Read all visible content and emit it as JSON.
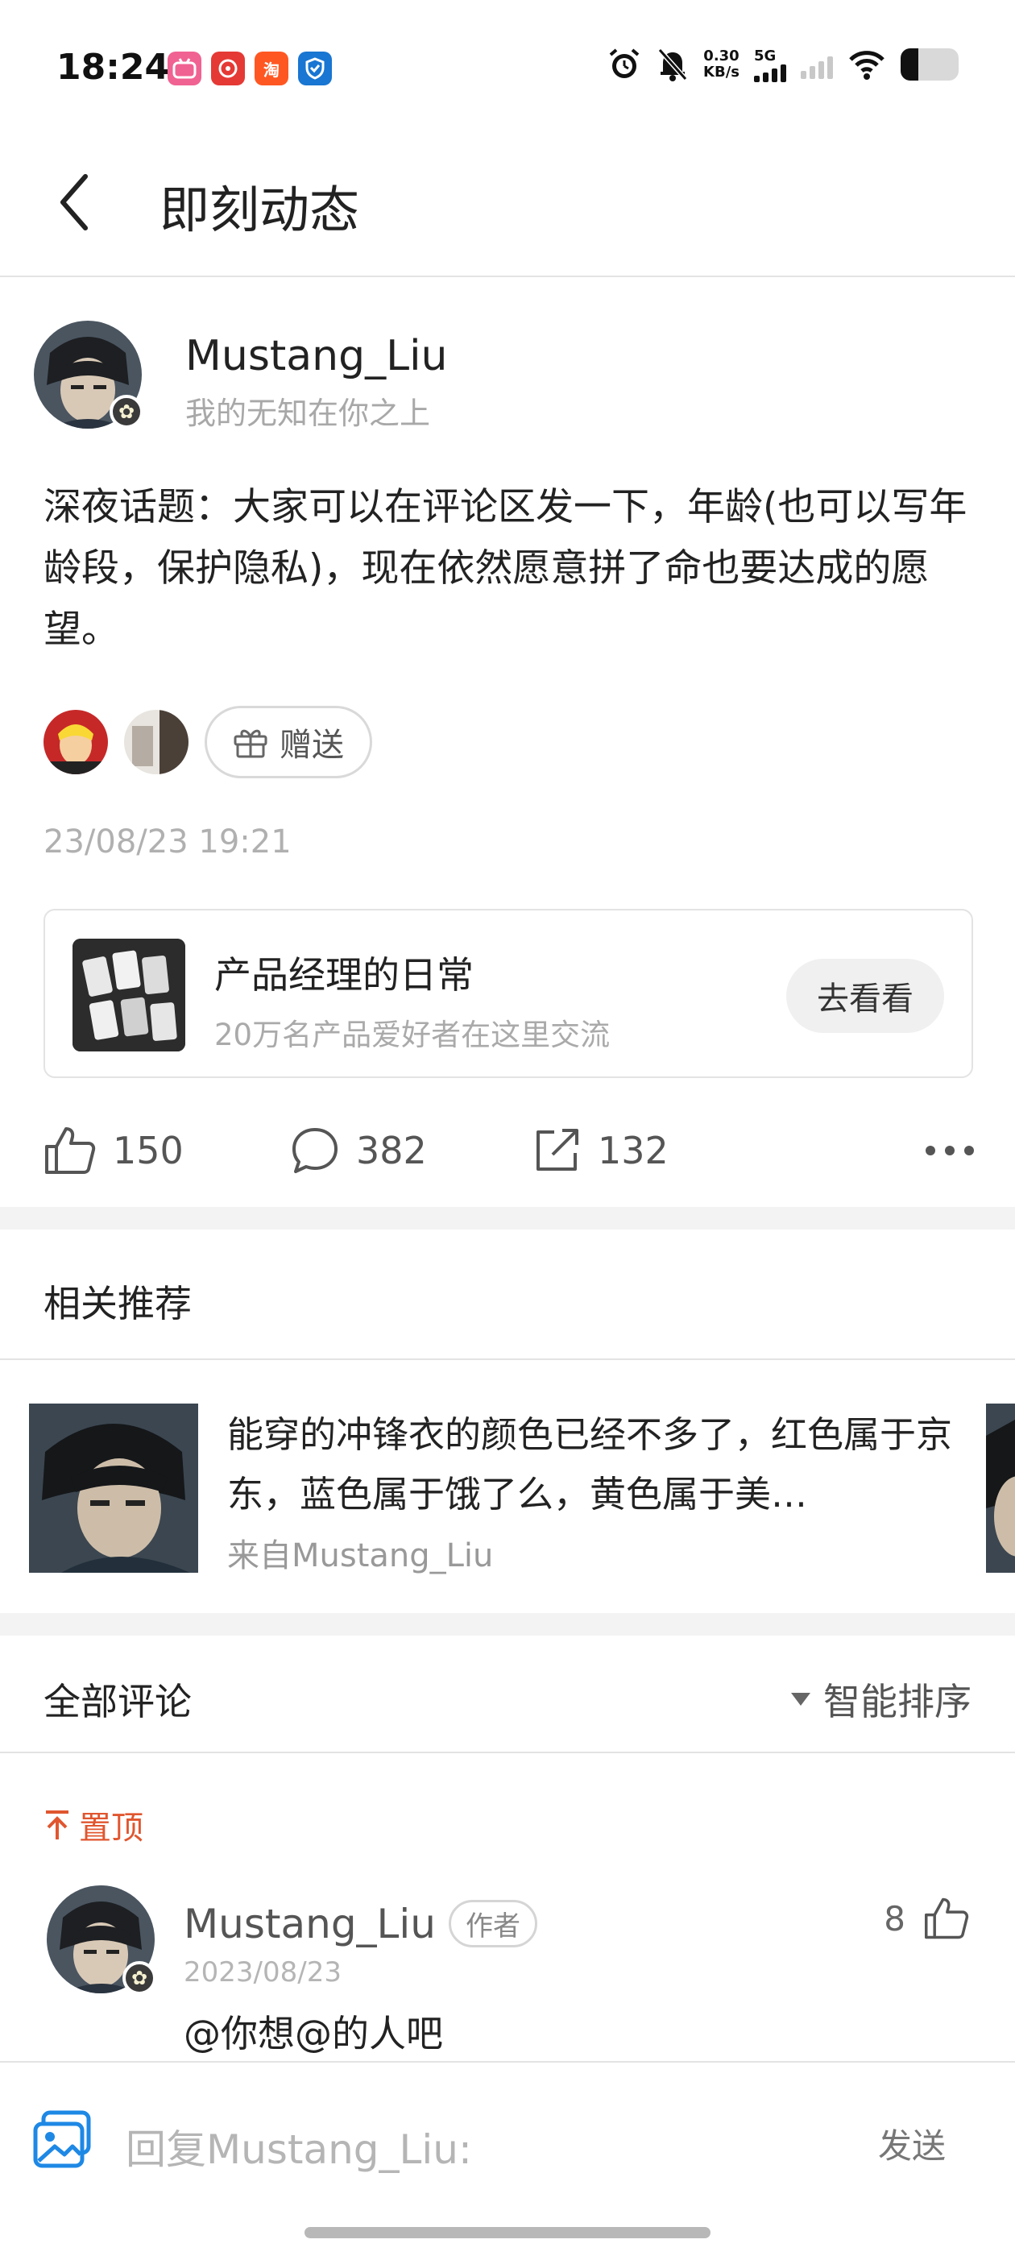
{
  "status_bar": {
    "time": "18:24",
    "net_speed_value": "0.30",
    "net_speed_unit": "KB/s",
    "signal_label": "5G",
    "battery_level": 0.3,
    "app_icons": [
      "bilibili-icon",
      "pinduoduo-icon",
      "taobao-icon",
      "shield-icon"
    ],
    "taobao_glyph": "淘"
  },
  "header": {
    "title": "即刻动态"
  },
  "post": {
    "author": {
      "name": "Mustang_Liu",
      "signature": "我的无知在你之上"
    },
    "text": "深夜话题：大家可以在评论区发一下，年龄(也可以写年龄段，保护隐私)，现在依然愿意拼了命也要达成的愿望。",
    "gift_label": "赠送",
    "time": "23/08/23 19:21",
    "topic": {
      "title": "产品经理的日常",
      "subtitle": "20万名产品爱好者在这里交流",
      "button": "去看看"
    },
    "actions": {
      "likes": "150",
      "comments": "382",
      "shares": "132"
    }
  },
  "recommend": {
    "section_title": "相关推荐",
    "item": {
      "text": "能穿的冲锋衣的颜色已经不多了，红色属于京东，蓝色属于饿了么，黄色属于美…",
      "source": "来自Mustang_Liu"
    }
  },
  "comments": {
    "section_title": "全部评论",
    "sort_label": "智能排序",
    "pinned_label": "置顶",
    "items": [
      {
        "name": "Mustang_Liu",
        "tag": "作者",
        "date": "2023/08/23",
        "likes": "8",
        "text": "@你想@的人吧"
      }
    ]
  },
  "reply": {
    "placeholder": "回复Mustang_Liu:",
    "send": "发送"
  },
  "colors": {
    "pinned": "#e0562f",
    "reply_icon": "#1e88e5"
  }
}
